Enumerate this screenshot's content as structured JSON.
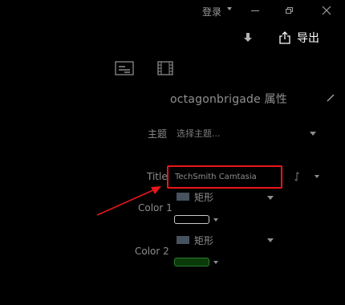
{
  "window": {
    "login_label": "登录"
  },
  "header": {
    "export_label": "导出"
  },
  "properties": {
    "title": "octagonbrigade 属性"
  },
  "theme": {
    "label": "主题",
    "placeholder": "选择主题..."
  },
  "title_field": {
    "label": "Title",
    "value": "TechSmith Camtasia"
  },
  "color1": {
    "label": "Color 1",
    "shape_label": "矩形",
    "swatch_color": "#000000",
    "swatch_border": "#c9c9c9"
  },
  "color2": {
    "label": "Color 2",
    "shape_label": "矩形",
    "swatch_color": "#0a3a0a",
    "swatch_border": "#2f7a2f"
  },
  "colors": {
    "background": "#000000",
    "annotation": "#e8161c",
    "shape_swatch": "#46525e"
  }
}
